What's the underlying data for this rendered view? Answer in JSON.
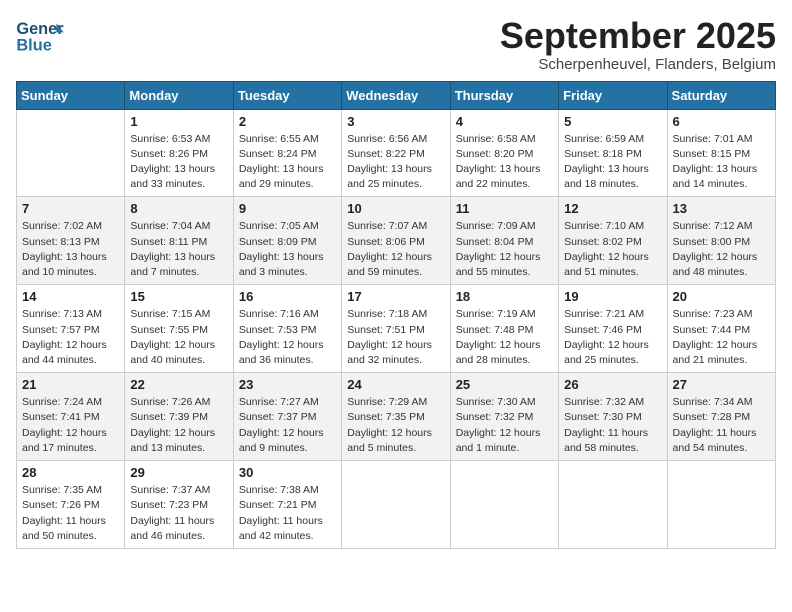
{
  "header": {
    "logo_general": "General",
    "logo_blue": "Blue",
    "month_title": "September 2025",
    "subtitle": "Scherpenheuvel, Flanders, Belgium"
  },
  "weekdays": [
    "Sunday",
    "Monday",
    "Tuesday",
    "Wednesday",
    "Thursday",
    "Friday",
    "Saturday"
  ],
  "weeks": [
    [
      {
        "day": "",
        "sunrise": "",
        "sunset": "",
        "daylight": ""
      },
      {
        "day": "1",
        "sunrise": "Sunrise: 6:53 AM",
        "sunset": "Sunset: 8:26 PM",
        "daylight": "Daylight: 13 hours and 33 minutes."
      },
      {
        "day": "2",
        "sunrise": "Sunrise: 6:55 AM",
        "sunset": "Sunset: 8:24 PM",
        "daylight": "Daylight: 13 hours and 29 minutes."
      },
      {
        "day": "3",
        "sunrise": "Sunrise: 6:56 AM",
        "sunset": "Sunset: 8:22 PM",
        "daylight": "Daylight: 13 hours and 25 minutes."
      },
      {
        "day": "4",
        "sunrise": "Sunrise: 6:58 AM",
        "sunset": "Sunset: 8:20 PM",
        "daylight": "Daylight: 13 hours and 22 minutes."
      },
      {
        "day": "5",
        "sunrise": "Sunrise: 6:59 AM",
        "sunset": "Sunset: 8:18 PM",
        "daylight": "Daylight: 13 hours and 18 minutes."
      },
      {
        "day": "6",
        "sunrise": "Sunrise: 7:01 AM",
        "sunset": "Sunset: 8:15 PM",
        "daylight": "Daylight: 13 hours and 14 minutes."
      }
    ],
    [
      {
        "day": "7",
        "sunrise": "Sunrise: 7:02 AM",
        "sunset": "Sunset: 8:13 PM",
        "daylight": "Daylight: 13 hours and 10 minutes."
      },
      {
        "day": "8",
        "sunrise": "Sunrise: 7:04 AM",
        "sunset": "Sunset: 8:11 PM",
        "daylight": "Daylight: 13 hours and 7 minutes."
      },
      {
        "day": "9",
        "sunrise": "Sunrise: 7:05 AM",
        "sunset": "Sunset: 8:09 PM",
        "daylight": "Daylight: 13 hours and 3 minutes."
      },
      {
        "day": "10",
        "sunrise": "Sunrise: 7:07 AM",
        "sunset": "Sunset: 8:06 PM",
        "daylight": "Daylight: 12 hours and 59 minutes."
      },
      {
        "day": "11",
        "sunrise": "Sunrise: 7:09 AM",
        "sunset": "Sunset: 8:04 PM",
        "daylight": "Daylight: 12 hours and 55 minutes."
      },
      {
        "day": "12",
        "sunrise": "Sunrise: 7:10 AM",
        "sunset": "Sunset: 8:02 PM",
        "daylight": "Daylight: 12 hours and 51 minutes."
      },
      {
        "day": "13",
        "sunrise": "Sunrise: 7:12 AM",
        "sunset": "Sunset: 8:00 PM",
        "daylight": "Daylight: 12 hours and 48 minutes."
      }
    ],
    [
      {
        "day": "14",
        "sunrise": "Sunrise: 7:13 AM",
        "sunset": "Sunset: 7:57 PM",
        "daylight": "Daylight: 12 hours and 44 minutes."
      },
      {
        "day": "15",
        "sunrise": "Sunrise: 7:15 AM",
        "sunset": "Sunset: 7:55 PM",
        "daylight": "Daylight: 12 hours and 40 minutes."
      },
      {
        "day": "16",
        "sunrise": "Sunrise: 7:16 AM",
        "sunset": "Sunset: 7:53 PM",
        "daylight": "Daylight: 12 hours and 36 minutes."
      },
      {
        "day": "17",
        "sunrise": "Sunrise: 7:18 AM",
        "sunset": "Sunset: 7:51 PM",
        "daylight": "Daylight: 12 hours and 32 minutes."
      },
      {
        "day": "18",
        "sunrise": "Sunrise: 7:19 AM",
        "sunset": "Sunset: 7:48 PM",
        "daylight": "Daylight: 12 hours and 28 minutes."
      },
      {
        "day": "19",
        "sunrise": "Sunrise: 7:21 AM",
        "sunset": "Sunset: 7:46 PM",
        "daylight": "Daylight: 12 hours and 25 minutes."
      },
      {
        "day": "20",
        "sunrise": "Sunrise: 7:23 AM",
        "sunset": "Sunset: 7:44 PM",
        "daylight": "Daylight: 12 hours and 21 minutes."
      }
    ],
    [
      {
        "day": "21",
        "sunrise": "Sunrise: 7:24 AM",
        "sunset": "Sunset: 7:41 PM",
        "daylight": "Daylight: 12 hours and 17 minutes."
      },
      {
        "day": "22",
        "sunrise": "Sunrise: 7:26 AM",
        "sunset": "Sunset: 7:39 PM",
        "daylight": "Daylight: 12 hours and 13 minutes."
      },
      {
        "day": "23",
        "sunrise": "Sunrise: 7:27 AM",
        "sunset": "Sunset: 7:37 PM",
        "daylight": "Daylight: 12 hours and 9 minutes."
      },
      {
        "day": "24",
        "sunrise": "Sunrise: 7:29 AM",
        "sunset": "Sunset: 7:35 PM",
        "daylight": "Daylight: 12 hours and 5 minutes."
      },
      {
        "day": "25",
        "sunrise": "Sunrise: 7:30 AM",
        "sunset": "Sunset: 7:32 PM",
        "daylight": "Daylight: 12 hours and 1 minute."
      },
      {
        "day": "26",
        "sunrise": "Sunrise: 7:32 AM",
        "sunset": "Sunset: 7:30 PM",
        "daylight": "Daylight: 11 hours and 58 minutes."
      },
      {
        "day": "27",
        "sunrise": "Sunrise: 7:34 AM",
        "sunset": "Sunset: 7:28 PM",
        "daylight": "Daylight: 11 hours and 54 minutes."
      }
    ],
    [
      {
        "day": "28",
        "sunrise": "Sunrise: 7:35 AM",
        "sunset": "Sunset: 7:26 PM",
        "daylight": "Daylight: 11 hours and 50 minutes."
      },
      {
        "day": "29",
        "sunrise": "Sunrise: 7:37 AM",
        "sunset": "Sunset: 7:23 PM",
        "daylight": "Daylight: 11 hours and 46 minutes."
      },
      {
        "day": "30",
        "sunrise": "Sunrise: 7:38 AM",
        "sunset": "Sunset: 7:21 PM",
        "daylight": "Daylight: 11 hours and 42 minutes."
      },
      {
        "day": "",
        "sunrise": "",
        "sunset": "",
        "daylight": ""
      },
      {
        "day": "",
        "sunrise": "",
        "sunset": "",
        "daylight": ""
      },
      {
        "day": "",
        "sunrise": "",
        "sunset": "",
        "daylight": ""
      },
      {
        "day": "",
        "sunrise": "",
        "sunset": "",
        "daylight": ""
      }
    ]
  ]
}
